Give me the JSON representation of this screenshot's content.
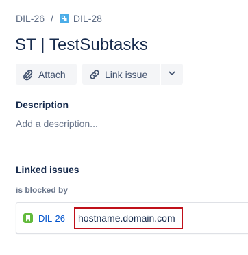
{
  "breadcrumb": {
    "parent_key": "DIL-26",
    "separator": "/",
    "current_key": "DIL-28"
  },
  "issue": {
    "title": "ST | TestSubtasks"
  },
  "toolbar": {
    "attach_label": "Attach",
    "link_issue_label": "Link issue"
  },
  "description": {
    "heading": "Description",
    "placeholder": "Add a description..."
  },
  "linked_issues": {
    "heading": "Linked issues",
    "relation": "is blocked by",
    "items": [
      {
        "key": "DIL-26",
        "summary": "hostname.domain.com",
        "type_icon": "story-icon"
      }
    ]
  },
  "colors": {
    "subtask_icon": "#4bade8",
    "story_icon": "#63ba3c",
    "link": "#0052cc",
    "highlight_border": "#c0101a"
  }
}
